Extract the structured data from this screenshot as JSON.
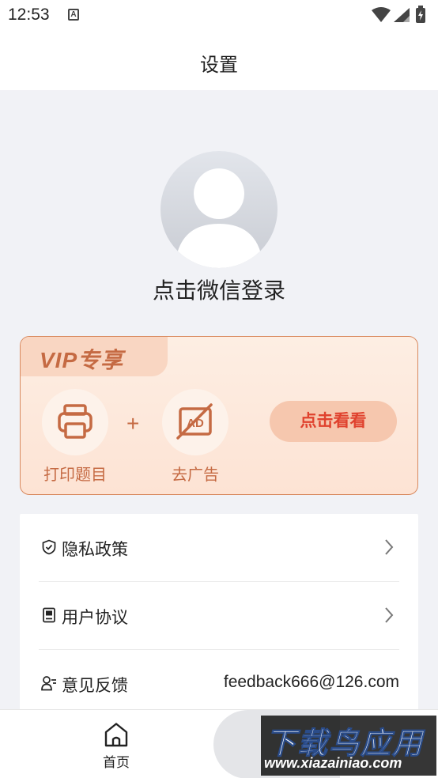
{
  "status_bar": {
    "time": "12:53",
    "notification_icon": "A"
  },
  "header": {
    "title": "设置"
  },
  "profile": {
    "login_label": "点击微信登录"
  },
  "vip": {
    "tab_label": "VIP专享",
    "features": [
      {
        "label": "打印题目",
        "icon": "printer-icon"
      },
      {
        "label": "去广告",
        "icon": "no-ad-icon"
      }
    ],
    "plus": "+",
    "cta_label": "点击看看"
  },
  "menu": {
    "items": [
      {
        "label": "隐私政策",
        "icon": "shield-check-icon"
      },
      {
        "label": "用户协议",
        "icon": "document-icon"
      },
      {
        "label": "意见反馈",
        "icon": "user-feedback-icon",
        "value": "feedback666@126.com"
      }
    ]
  },
  "bottom_nav": {
    "home_label": "首页"
  },
  "watermark": {
    "title": "下载鸟应用",
    "url": "www.xiazainiao.com"
  },
  "colors": {
    "accent": "#c56a43",
    "cta_text": "#e0422e",
    "card_border": "#d9895e"
  }
}
